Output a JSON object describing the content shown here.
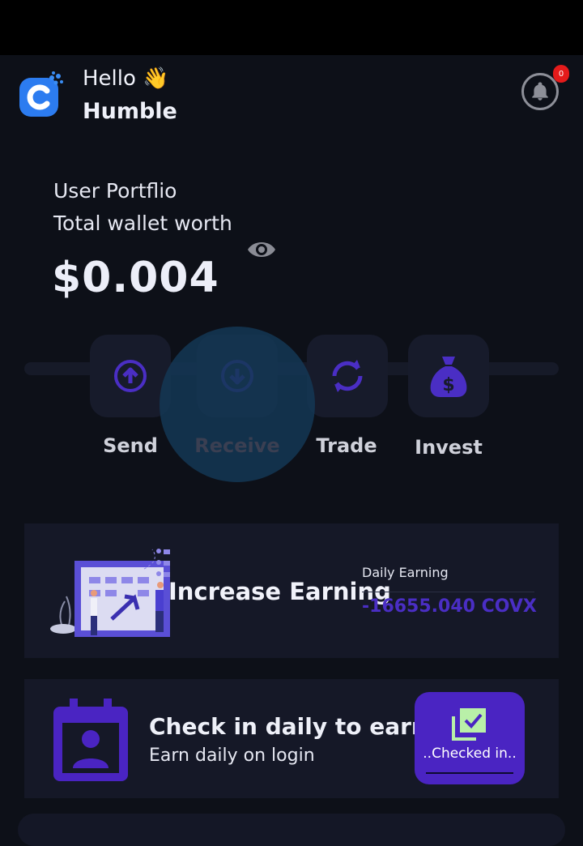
{
  "header": {
    "greeting": "Hello 👋",
    "username": "Humble",
    "notification_count": "0"
  },
  "portfolio": {
    "line1": "User Portflio",
    "line2": "Total wallet worth",
    "amount": "$0.004"
  },
  "actions": [
    {
      "label": "Send",
      "icon": "upload-arrow-icon"
    },
    {
      "label": "Receive",
      "icon": "download-arrow-icon"
    },
    {
      "label": "Trade",
      "icon": "refresh-icon"
    },
    {
      "label": "Invest",
      "icon": "money-bag-icon"
    }
  ],
  "earning": {
    "title": "Increase Earning",
    "daily_label": "Daily Earning",
    "daily_value": "-16655.040 COVX"
  },
  "checkin": {
    "title": "Check in daily to earn",
    "subtitle": "Earn daily on login",
    "button_label": "..Checked in.."
  },
  "colors": {
    "background": "#0d1018",
    "card": "#151827",
    "accent": "#4a24c2",
    "icon": "#4a2ec4",
    "badge": "#e51b1b"
  }
}
